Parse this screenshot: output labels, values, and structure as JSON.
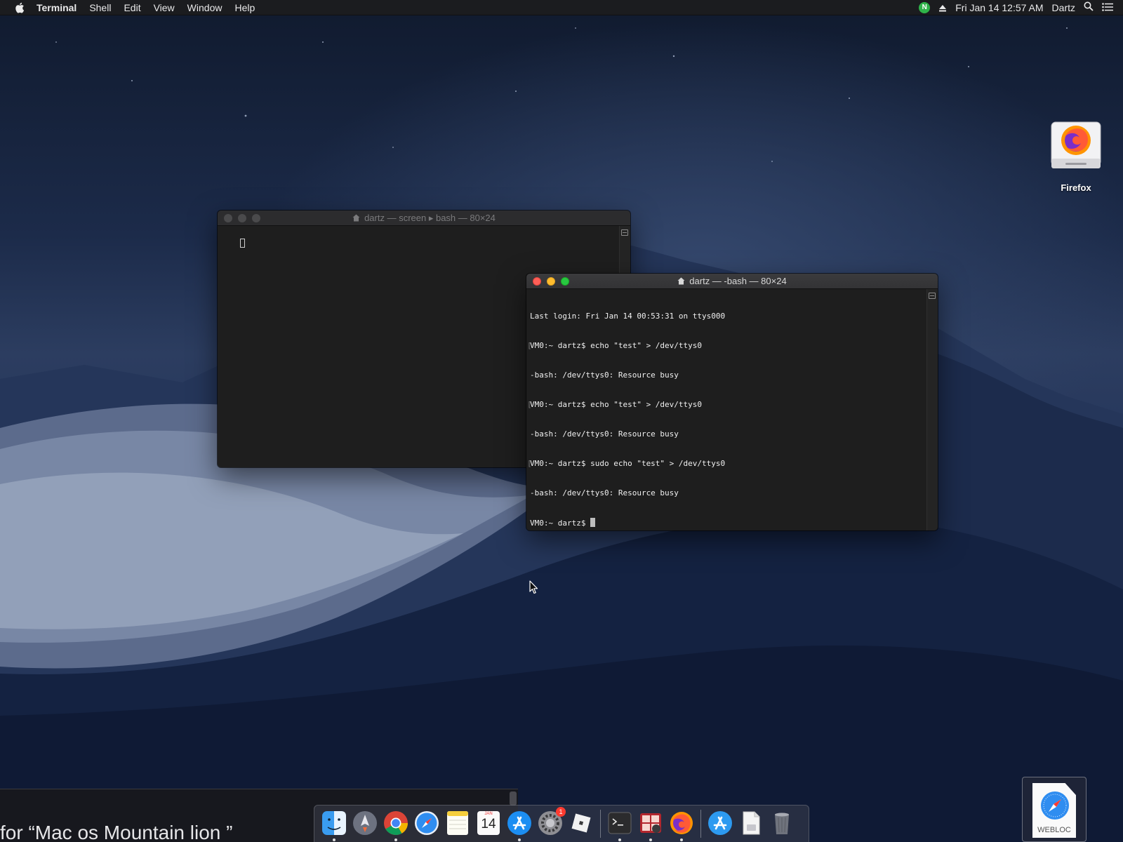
{
  "menubar": {
    "apple_icon": "apple-icon",
    "app_name": "Terminal",
    "items": [
      "Shell",
      "Edit",
      "View",
      "Window",
      "Help"
    ],
    "status_n": "N",
    "clock": "Fri Jan 14  12:57 AM",
    "username": "Dartz"
  },
  "desktop": {
    "icons": [
      {
        "label": "Firefox",
        "icon": "firefox-disk-icon"
      }
    ]
  },
  "windows": {
    "back": {
      "title": "dartz — screen ▸ bash — 80×24"
    },
    "front": {
      "title": "dartz — -bash — 80×24",
      "lines": [
        "Last login: Fri Jan 14 00:53:31 on ttys000",
        "VM0:~ dartz$ echo \"test\" > /dev/ttys0",
        "-bash: /dev/ttys0: Resource busy",
        "VM0:~ dartz$ echo \"test\" > /dev/ttys0",
        "-bash: /dev/ttys0: Resource busy",
        "VM0:~ dartz$ sudo echo \"test\" > /dev/ttys0",
        "-bash: /dev/ttys0: Resource busy",
        "VM0:~ dartz$ "
      ]
    }
  },
  "search_strip": {
    "text": "for “Mac os Mountain lion ”"
  },
  "dock": {
    "apps": [
      "finder-icon",
      "launchpad-icon",
      "chrome-icon",
      "safari-icon",
      "notes-icon",
      "calendar-icon",
      "app-store-icon",
      "system-preferences-icon",
      "roblox-icon",
      "terminal-icon",
      "photo-booth-icon",
      "firefox-icon",
      "app-store-folder-icon",
      "documents-folder-icon",
      "trash-icon"
    ],
    "calendar_month": "JAN",
    "calendar_day": "14",
    "system_prefs_badge": "1"
  },
  "webloc": {
    "label": "WEBLOC"
  },
  "colors": {
    "close": "#fe5f57",
    "minimize": "#febc2e",
    "maximize": "#28c840",
    "terminal_bg": "#1e1e1e",
    "terminal_fg": "#f0f0f0"
  }
}
